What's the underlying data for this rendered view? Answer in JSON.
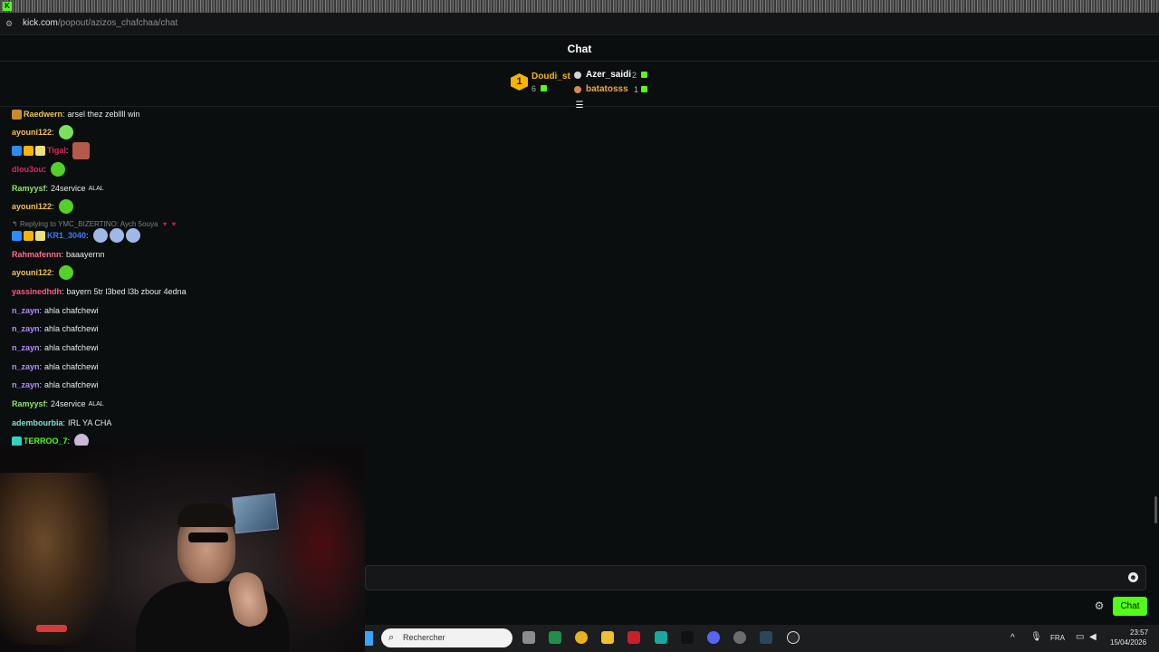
{
  "browser": {
    "url_host": "kick.com",
    "url_path": "/popout/azizos_chafchaa/chat"
  },
  "chat": {
    "title": "Chat"
  },
  "leaderboard": {
    "first": {
      "rank": "1",
      "name": "Doudi_st",
      "count": "6"
    },
    "second": {
      "name": "Azer_saidi",
      "count": "2"
    },
    "third": {
      "name": "batatosss",
      "count": "1"
    }
  },
  "messages": [
    {
      "user": "Raedwern",
      "text": "arsel thez zebllll win",
      "color": "#f2c14e"
    },
    {
      "user": "ayouni122",
      "text": "",
      "color": "#f2c14e"
    },
    {
      "user": "Tigal",
      "text": "",
      "color": "#e0245e"
    },
    {
      "user": "dlou3ou",
      "text": "",
      "color": "#e0245e"
    },
    {
      "user": "Ramyysf",
      "text": "24service",
      "suffix": "ALAL",
      "color": "#8ee26b"
    },
    {
      "user": "ayouni122",
      "text": "",
      "color": "#f2c14e"
    },
    {
      "user": "KR1_3040",
      "text": "",
      "color": "#3d7bff"
    },
    {
      "user": "Rahmafennn",
      "text": "baaayernn",
      "color": "#ff6b8a"
    },
    {
      "user": "ayouni122",
      "text": "",
      "color": "#f2c14e"
    },
    {
      "user": "yassinedhdh",
      "text": "bayern 5tr l3bed l3b zbour 4edna",
      "color": "#ff5c8a"
    },
    {
      "user": "n_zayn",
      "text": "ahla chafchewi",
      "color": "#b58cff"
    },
    {
      "user": "n_zayn",
      "text": "ahla chafchewi",
      "color": "#b58cff"
    },
    {
      "user": "n_zayn",
      "text": "ahla chafchewi",
      "color": "#b58cff"
    },
    {
      "user": "n_zayn",
      "text": "ahla chafchewi",
      "color": "#b58cff"
    },
    {
      "user": "n_zayn",
      "text": "ahla chafchewi",
      "color": "#b58cff"
    },
    {
      "user": "Ramyysf",
      "text": "24service",
      "suffix": "ALAL",
      "color": "#8ee26b"
    },
    {
      "user": "adembourbia",
      "text": "IRL YA CHA",
      "color": "#7ee0d2"
    },
    {
      "user": "TERROO_7",
      "text": "",
      "color": "#53fc18"
    }
  ],
  "reply": {
    "text": "Replying to YMC_BIZERTINO: Aych 5ouya"
  },
  "input": {
    "placeholder": "",
    "send_label": "Chat"
  },
  "taskbar": {
    "search_placeholder": "Rechercher",
    "language": "FRA",
    "time": "23:57",
    "date": "15/04/2026"
  },
  "colors": {
    "accent": "#53fc18",
    "background": "#0b0e0f"
  }
}
